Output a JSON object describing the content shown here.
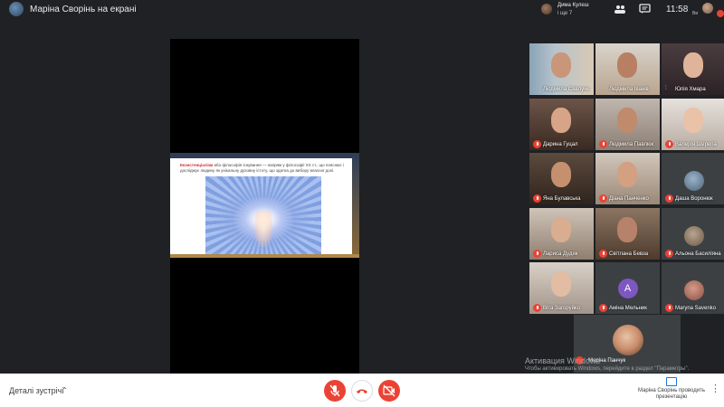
{
  "header": {
    "title": "Маріна Сворінь на екрані",
    "notification": {
      "name": "Дима Кулеш",
      "more": "і ще 7"
    },
    "time": "11:58",
    "user_label": "Ви"
  },
  "slide": {
    "term": "Екзистенціалізм",
    "text": " або філософія існування — напрям у філософії XX ст., що пояснює і досліджує людину як унікальну духовну істоту, що здатна до вибору власної долі."
  },
  "participants": [
    {
      "name": "Людмила Савлучк",
      "mic": "talking"
    },
    {
      "name": "Людмила Іванів",
      "mic": "talking"
    },
    {
      "name": "Юлія Хмара",
      "mic": "talking"
    },
    {
      "name": "Дарина Гуцал",
      "mic": "muted"
    },
    {
      "name": "Людмила Павлюк",
      "mic": "muted"
    },
    {
      "name": "Валерія Шерепа",
      "mic": "muted"
    },
    {
      "name": "Яна Булавська",
      "mic": "muted"
    },
    {
      "name": "Діана Панченко",
      "mic": "muted"
    },
    {
      "name": "Даша Воронюк",
      "mic": "muted"
    },
    {
      "name": "Лариса Дудяк",
      "mic": "muted"
    },
    {
      "name": "Світлана Бевза",
      "mic": "muted"
    },
    {
      "name": "Альона Басиліяна",
      "mic": "muted"
    },
    {
      "name": "Віта Загоруйко",
      "mic": "muted"
    },
    {
      "name": "Аміна Мельник",
      "mic": "muted",
      "letter": "A"
    },
    {
      "name": "Maryna Savenko",
      "mic": "muted"
    }
  ],
  "featured": {
    "name": "Маріна Панчук"
  },
  "watermark": {
    "title": "Активация Windows",
    "subtitle": "Чтобы активировать Windows, перейдите в раздел \"Параметры\"."
  },
  "bottom": {
    "meeting_details": "Деталі зустрічі",
    "presenter_label": "Маріна Сворінь проводить презентацію"
  },
  "colors": {
    "accent": "#1a73e8",
    "danger": "#ea4335",
    "background": "#202124"
  }
}
